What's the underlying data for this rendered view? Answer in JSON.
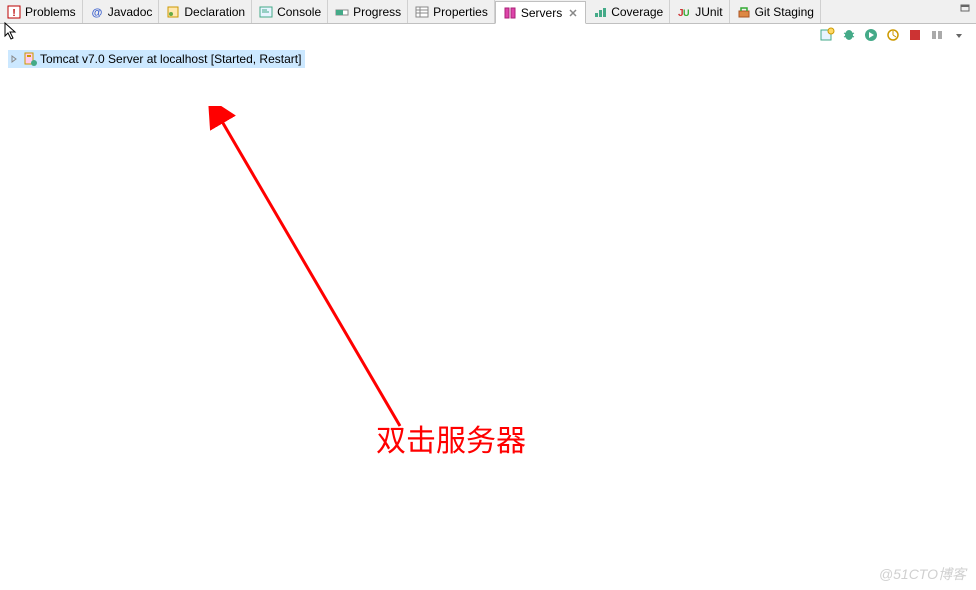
{
  "tabs": [
    {
      "label": "Problems"
    },
    {
      "label": "Javadoc"
    },
    {
      "label": "Declaration"
    },
    {
      "label": "Console"
    },
    {
      "label": "Progress"
    },
    {
      "label": "Properties"
    },
    {
      "label": "Servers"
    },
    {
      "label": "Coverage"
    },
    {
      "label": "JUnit"
    },
    {
      "label": "Git Staging"
    }
  ],
  "server": {
    "label": "Tomcat v7.0 Server at localhost  [Started, Restart]"
  },
  "annotation": {
    "text": "双击服务器"
  },
  "watermark": "@51CTO博客"
}
